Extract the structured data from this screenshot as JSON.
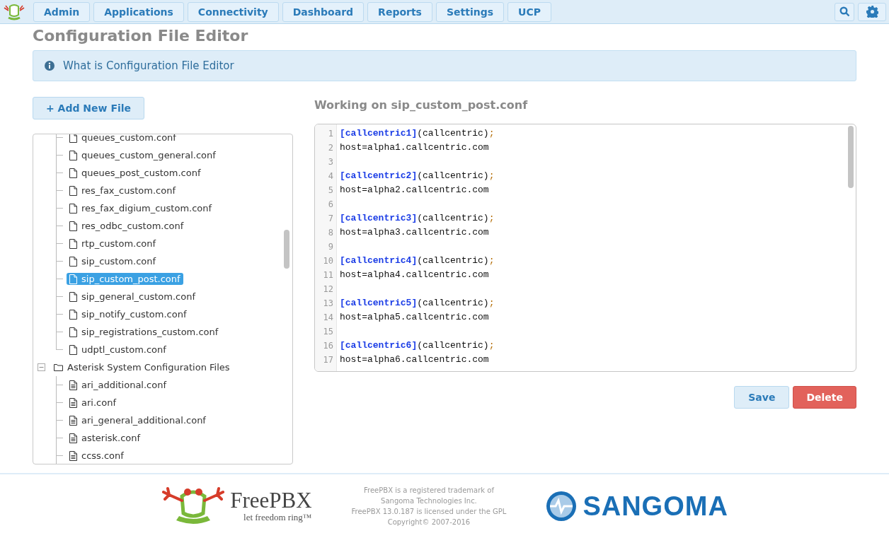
{
  "nav": {
    "tabs": [
      {
        "label": "Admin",
        "selected": false
      },
      {
        "label": "Applications",
        "selected": false
      },
      {
        "label": "Connectivity",
        "selected": false
      },
      {
        "label": "Dashboard",
        "selected": false
      },
      {
        "label": "Reports",
        "selected": false
      },
      {
        "label": "Settings",
        "selected": false
      },
      {
        "label": "UCP",
        "selected": false
      }
    ]
  },
  "page_title": "Configuration File Editor",
  "info_panel": {
    "text": "What is Configuration File Editor"
  },
  "add_button": "+ Add New File",
  "tree": {
    "nodes": [
      {
        "kind": "continued",
        "children": [
          {
            "kind": "file",
            "label": "queues_custom.conf",
            "selected": false
          },
          {
            "kind": "file",
            "label": "queues_custom_general.conf",
            "selected": false
          },
          {
            "kind": "file",
            "label": "queues_post_custom.conf",
            "selected": false
          },
          {
            "kind": "file",
            "label": "res_fax_custom.conf",
            "selected": false
          },
          {
            "kind": "file",
            "label": "res_fax_digium_custom.conf",
            "selected": false
          },
          {
            "kind": "file",
            "label": "res_odbc_custom.conf",
            "selected": false
          },
          {
            "kind": "file",
            "label": "rtp_custom.conf",
            "selected": false
          },
          {
            "kind": "file",
            "label": "sip_custom.conf",
            "selected": false
          },
          {
            "kind": "file",
            "label": "sip_custom_post.conf",
            "selected": true
          },
          {
            "kind": "file",
            "label": "sip_general_custom.conf",
            "selected": false
          },
          {
            "kind": "file",
            "label": "sip_notify_custom.conf",
            "selected": false
          },
          {
            "kind": "file",
            "label": "sip_registrations_custom.conf",
            "selected": false
          },
          {
            "kind": "file",
            "label": "udptl_custom.conf",
            "selected": false
          }
        ]
      },
      {
        "kind": "folder",
        "label": "Asterisk System Configuration Files",
        "expanded": true,
        "children": [
          {
            "kind": "text-file",
            "label": "ari_additional.conf",
            "selected": false
          },
          {
            "kind": "text-file",
            "label": "ari.conf",
            "selected": false
          },
          {
            "kind": "text-file",
            "label": "ari_general_additional.conf",
            "selected": false
          },
          {
            "kind": "text-file",
            "label": "asterisk.conf",
            "selected": false
          },
          {
            "kind": "text-file",
            "label": "ccss.conf",
            "selected": false
          }
        ]
      }
    ]
  },
  "editor": {
    "heading": "Working on sip_custom_post.conf",
    "lines": [
      {
        "kind": "section",
        "number": "1",
        "section": "[callcentric1]",
        "args": "(callcentric)",
        "end": ";"
      },
      {
        "kind": "plain",
        "number": "2",
        "text": "host=alpha1.callcentric.com"
      },
      {
        "kind": "blank",
        "number": "3"
      },
      {
        "kind": "section",
        "number": "4",
        "section": "[callcentric2]",
        "args": "(callcentric)",
        "end": ";"
      },
      {
        "kind": "plain",
        "number": "5",
        "text": "host=alpha2.callcentric.com"
      },
      {
        "kind": "blank",
        "number": "6"
      },
      {
        "kind": "section",
        "number": "7",
        "section": "[callcentric3]",
        "args": "(callcentric)",
        "end": ";"
      },
      {
        "kind": "plain",
        "number": "8",
        "text": "host=alpha3.callcentric.com"
      },
      {
        "kind": "blank",
        "number": "9"
      },
      {
        "kind": "section",
        "number": "10",
        "section": "[callcentric4]",
        "args": "(callcentric)",
        "end": ";"
      },
      {
        "kind": "plain",
        "number": "11",
        "text": "host=alpha4.callcentric.com"
      },
      {
        "kind": "blank",
        "number": "12"
      },
      {
        "kind": "section",
        "number": "13",
        "section": "[callcentric5]",
        "args": "(callcentric)",
        "end": ";"
      },
      {
        "kind": "plain",
        "number": "14",
        "text": "host=alpha5.callcentric.com"
      },
      {
        "kind": "blank",
        "number": "15"
      },
      {
        "kind": "section",
        "number": "16",
        "section": "[callcentric6]",
        "args": "(callcentric)",
        "end": ";"
      },
      {
        "kind": "plain",
        "number": "17",
        "text": "host=alpha6.callcentric.com"
      }
    ],
    "buttons": [
      {
        "kind": "save",
        "label": "Save"
      },
      {
        "kind": "delete",
        "label": "Delete"
      }
    ]
  },
  "footer": {
    "brand": "FreePBX",
    "tagline": "let freedom ring™",
    "legal": [
      "FreePBX is a registered trademark of",
      "Sangoma Technologies Inc.",
      "FreePBX 13.0.187 is licensed under the GPL",
      "Copyright© 2007-2016"
    ],
    "partner": "SANGOMA"
  }
}
